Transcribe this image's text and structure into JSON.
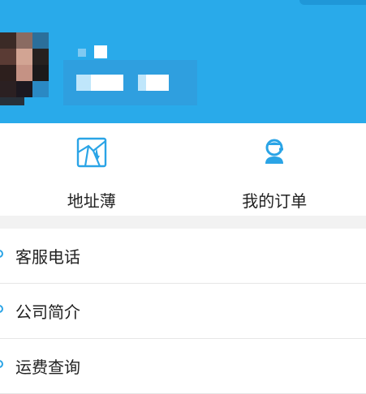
{
  "quick_actions": [
    {
      "label": "地址薄",
      "icon": "address-map-icon"
    },
    {
      "label": "我的订单",
      "icon": "order-person-icon"
    }
  ],
  "menu": [
    {
      "label": "客服电话"
    },
    {
      "label": "公司简介"
    },
    {
      "label": "运费查询"
    }
  ],
  "colors": {
    "header_bg": "#29aaea",
    "accent": "#2aa4e6",
    "divider": "#e6e6e6",
    "section_gap": "#f2f2f2"
  }
}
